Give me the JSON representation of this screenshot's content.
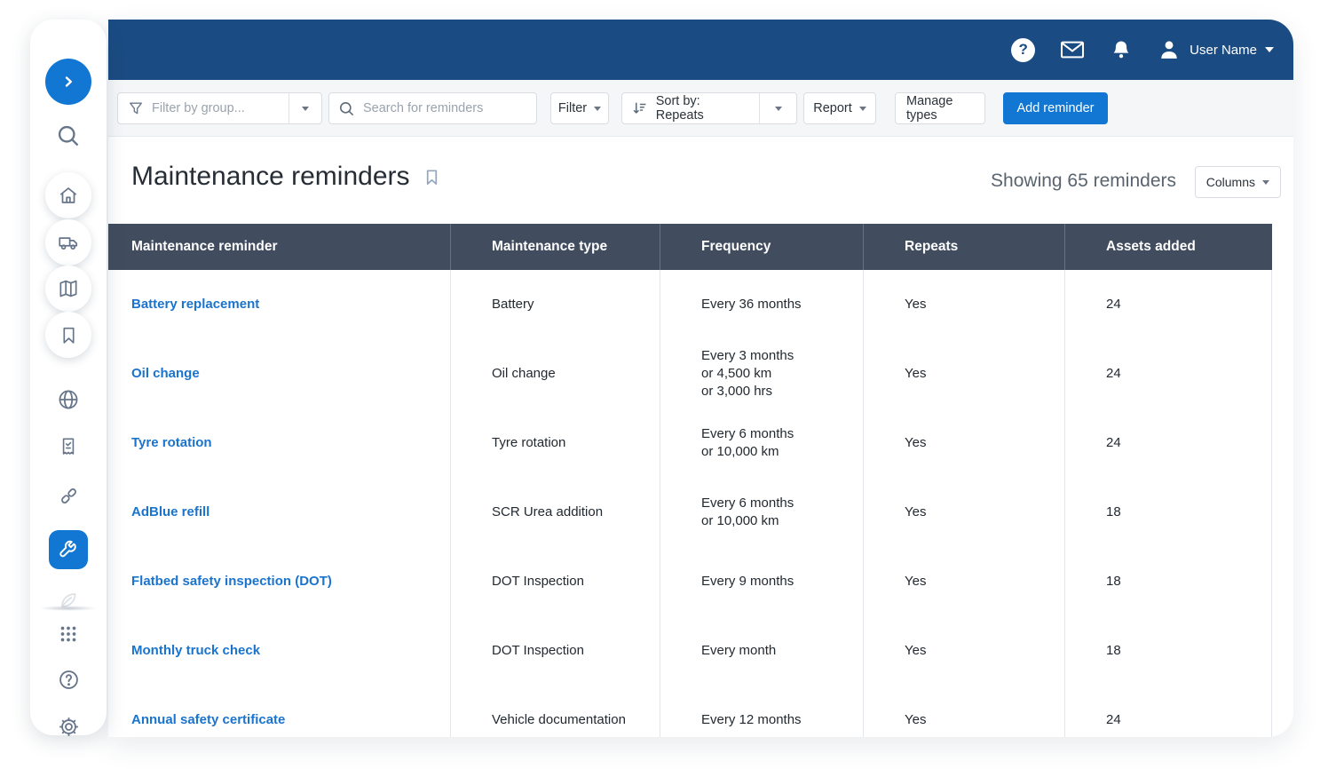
{
  "colors": {
    "topbar_blue": "#1a4b82",
    "accent_blue": "#1277d2",
    "link_blue": "#1a73cd",
    "table_header_bg": "#414d5f"
  },
  "topbar": {
    "icons": [
      "help-icon",
      "mail-icon",
      "bell-icon",
      "user-avatar-icon"
    ],
    "user_name": "User Name"
  },
  "toolbar": {
    "filter_group_placeholder": "Filter by group...",
    "search_placeholder": "Search for reminders",
    "filter_label": "Filter",
    "sort_label": "Sort by: Repeats",
    "report_label": "Report",
    "manage_types_label": "Manage types",
    "add_reminder_label": "Add reminder"
  },
  "page": {
    "title": "Maintenance reminders",
    "showing": "Showing 65 reminders",
    "columns_label": "Columns"
  },
  "sidebar": {
    "items": [
      {
        "icon": "expand-chevron-icon",
        "style": "expand"
      },
      {
        "icon": "search-icon",
        "style": "plain"
      },
      {
        "icon": "home-icon",
        "style": "circled"
      },
      {
        "icon": "truck-icon",
        "style": "circled"
      },
      {
        "icon": "map-icon",
        "style": "circled"
      },
      {
        "icon": "bookmark-icon",
        "style": "circled"
      },
      {
        "icon": "globe-icon",
        "style": "plain"
      },
      {
        "icon": "report-doc-icon",
        "style": "plain"
      },
      {
        "icon": "link-icon",
        "style": "plain"
      },
      {
        "icon": "wrench-icon",
        "style": "selected"
      },
      {
        "icon": "leaf-icon",
        "style": "faded"
      },
      {
        "icon": "apps-grid-icon",
        "style": "plain"
      },
      {
        "icon": "help-outline-icon",
        "style": "plain"
      },
      {
        "icon": "settings-gear-icon",
        "style": "plain"
      }
    ]
  },
  "table": {
    "headers": [
      "Maintenance reminder",
      "Maintenance type",
      "Frequency",
      "Repeats",
      "Assets added"
    ],
    "rows": [
      {
        "name": "Battery replacement",
        "type": "Battery",
        "frequency": [
          "Every 36 months"
        ],
        "repeats": "Yes",
        "assets": "24"
      },
      {
        "name": "Oil change",
        "type": "Oil change",
        "frequency": [
          "Every 3 months",
          "or 4,500 km",
          "or 3,000 hrs"
        ],
        "repeats": "Yes",
        "assets": "24"
      },
      {
        "name": "Tyre rotation",
        "type": "Tyre rotation",
        "frequency": [
          "Every 6 months",
          "or 10,000 km"
        ],
        "repeats": "Yes",
        "assets": "24"
      },
      {
        "name": "AdBlue refill",
        "type": "SCR Urea addition",
        "frequency": [
          "Every 6 months",
          "or 10,000 km"
        ],
        "repeats": "Yes",
        "assets": "18"
      },
      {
        "name": "Flatbed safety inspection (DOT)",
        "type": "DOT Inspection",
        "frequency": [
          "Every 9 months"
        ],
        "repeats": "Yes",
        "assets": "18"
      },
      {
        "name": "Monthly truck check",
        "type": "DOT Inspection",
        "frequency": [
          "Every month"
        ],
        "repeats": "Yes",
        "assets": "18"
      },
      {
        "name": "Annual safety certificate",
        "type": "Vehicle documentation",
        "frequency": [
          "Every 12 months"
        ],
        "repeats": "Yes",
        "assets": "24"
      }
    ]
  }
}
